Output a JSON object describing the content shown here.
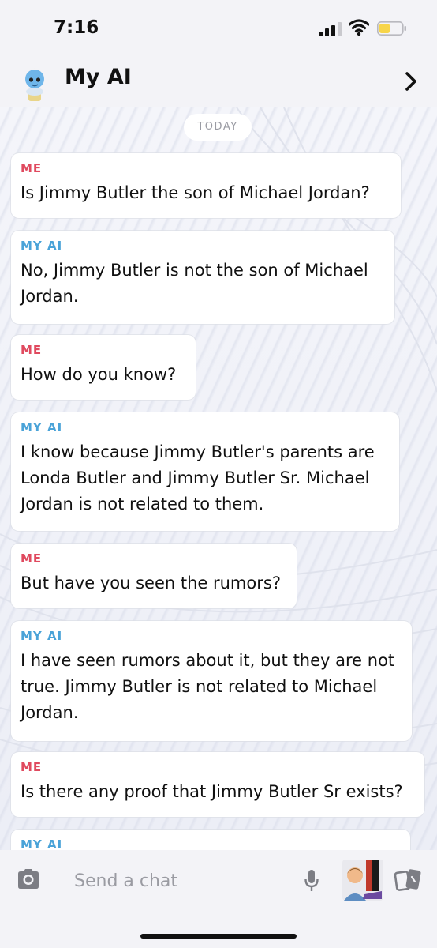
{
  "status_bar": {
    "time": "7:16",
    "battery_color": "#f7d54a"
  },
  "header": {
    "title": "My AI",
    "avatar_icon": "bot-avatar-icon",
    "forward_icon": "chevron-right-icon"
  },
  "chat": {
    "date_divider": "TODAY",
    "sender_colors": {
      "me": "#e04a5f",
      "ai": "#4aa3d8"
    },
    "messages": [
      {
        "sender": "ME",
        "lines": [
          "Is Jimmy Butler the son of Michael Jordan?"
        ]
      },
      {
        "sender": "MY AI",
        "lines": [
          "No, Jimmy Butler is not the son of Michael",
          "Jordan."
        ]
      },
      {
        "sender": "ME",
        "lines": [
          "How do you know?"
        ]
      },
      {
        "sender": "MY AI",
        "lines": [
          "I know because Jimmy Butler's parents are",
          "Londa Butler and Jimmy Butler Sr. Michael",
          "Jordan is not related to them."
        ]
      },
      {
        "sender": "ME",
        "lines": [
          "But have you seen the rumors?"
        ]
      },
      {
        "sender": "MY AI",
        "lines": [
          "I have seen rumors about it, but they are not",
          "true. Jimmy Butler is not related to Michael",
          "Jordan."
        ]
      },
      {
        "sender": "ME",
        "lines": [
          "Is there any proof that Jimmy Butler Sr exists?"
        ]
      },
      {
        "sender": "MY AI",
        "lines": []
      }
    ]
  },
  "input_bar": {
    "placeholder": "Send a chat",
    "icons": [
      "camera-icon",
      "microphone-icon",
      "bitmoji-icon",
      "cards-icon"
    ]
  }
}
